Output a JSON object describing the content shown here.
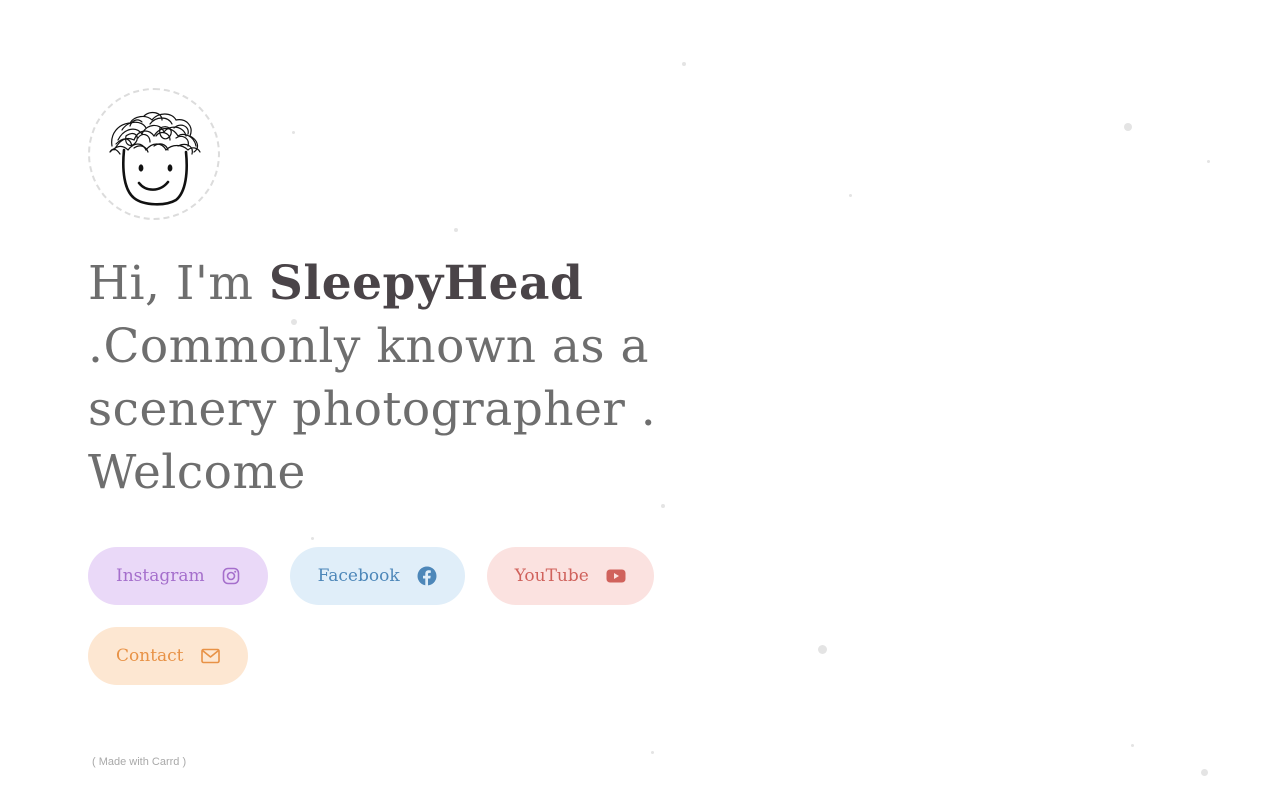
{
  "profile": {
    "avatar_alt": "sketch of a smiling face with messy hair"
  },
  "headline": {
    "greeting": "Hi, I'm ",
    "name": "SleepyHead",
    "line2": ".Commonly known as a",
    "line3": "scenery photographer .",
    "line4": "Welcome"
  },
  "links": [
    {
      "label": "Instagram",
      "icon": "instagram-icon",
      "color": "#a56fcc",
      "background": "#ead9f8"
    },
    {
      "label": "Facebook",
      "icon": "facebook-icon",
      "color": "#4d87b9",
      "background": "#e0eef9"
    },
    {
      "label": "YouTube",
      "icon": "youtube-icon",
      "color": "#d0625c",
      "background": "#fbe2e0"
    },
    {
      "label": "Contact",
      "icon": "envelope-icon",
      "color": "#e89246",
      "background": "#fde7d2"
    }
  ],
  "footer": {
    "credit": "( Made with Carrd )"
  }
}
